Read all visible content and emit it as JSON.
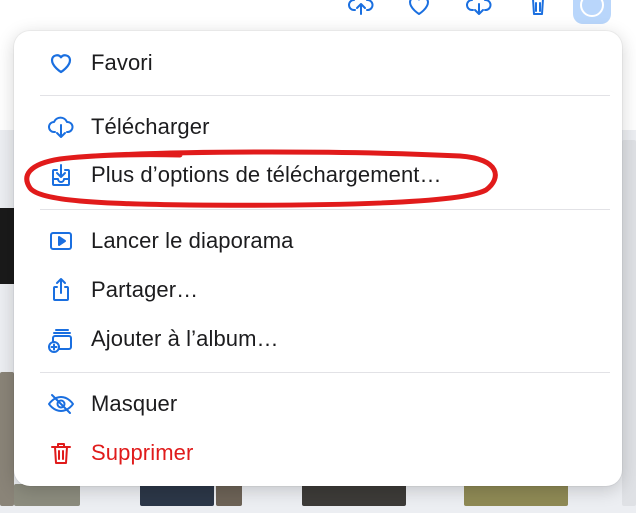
{
  "colors": {
    "accent": "#1a6fe0",
    "danger": "#e01b1b",
    "annotation": "#e11b1b",
    "more_button": "#b9d6fb"
  },
  "toolbar": {
    "icons": [
      "cloud-upload-icon",
      "heart-icon",
      "cloud-download-icon",
      "trash-icon",
      "more-icon"
    ]
  },
  "menu": {
    "favorite": {
      "label": "Favori",
      "icon": "heart-icon"
    },
    "download": {
      "label": "Télécharger",
      "icon": "cloud-download-icon"
    },
    "more_download": {
      "label": "Plus d’options de téléchargement…",
      "icon": "download-tray-icon"
    },
    "slideshow": {
      "label": "Lancer le diaporama",
      "icon": "play-icon"
    },
    "share": {
      "label": "Partager…",
      "icon": "share-icon"
    },
    "add_album": {
      "label": "Ajouter à l’album…",
      "icon": "add-album-icon"
    },
    "hide": {
      "label": "Masquer",
      "icon": "eye-slash-icon"
    },
    "delete": {
      "label": "Supprimer",
      "icon": "trash-icon"
    }
  }
}
